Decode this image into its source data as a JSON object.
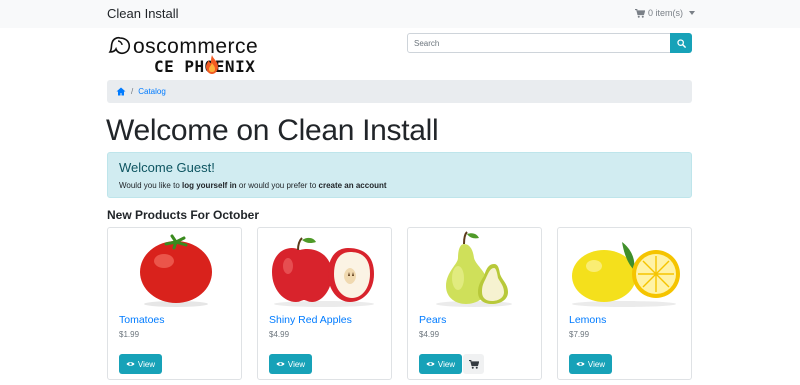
{
  "header": {
    "brand": "Clean Install",
    "cart_label": "0 item(s)"
  },
  "logo": {
    "word": "oscommerce",
    "sub": "CE PHOENIX"
  },
  "search": {
    "placeholder": "Search"
  },
  "breadcrumb": {
    "separator": "/",
    "current": "Catalog"
  },
  "page_title": "Welcome on Clean Install",
  "welcome": {
    "title": "Welcome Guest!",
    "text_before": "Would you like to ",
    "login_link": "log yourself in",
    "text_middle": " or would you prefer to ",
    "create_link": "create an account"
  },
  "new_products": {
    "title": "New Products For October",
    "products": [
      {
        "name": "Tomatoes",
        "price": "$1.99",
        "button": "View"
      },
      {
        "name": "Shiny Red Apples",
        "price": "$4.99",
        "button": "View"
      },
      {
        "name": "Pears",
        "price": "$4.99",
        "button": "View"
      },
      {
        "name": "Lemons",
        "price": "$7.99",
        "button": "View"
      }
    ]
  },
  "colors": {
    "accent": "#17a2b8",
    "link": "#007bff",
    "alert_bg": "#d1ecf1",
    "breadcrumb_bg": "#e9ecef",
    "topbar_bg": "#f8f9fa"
  }
}
